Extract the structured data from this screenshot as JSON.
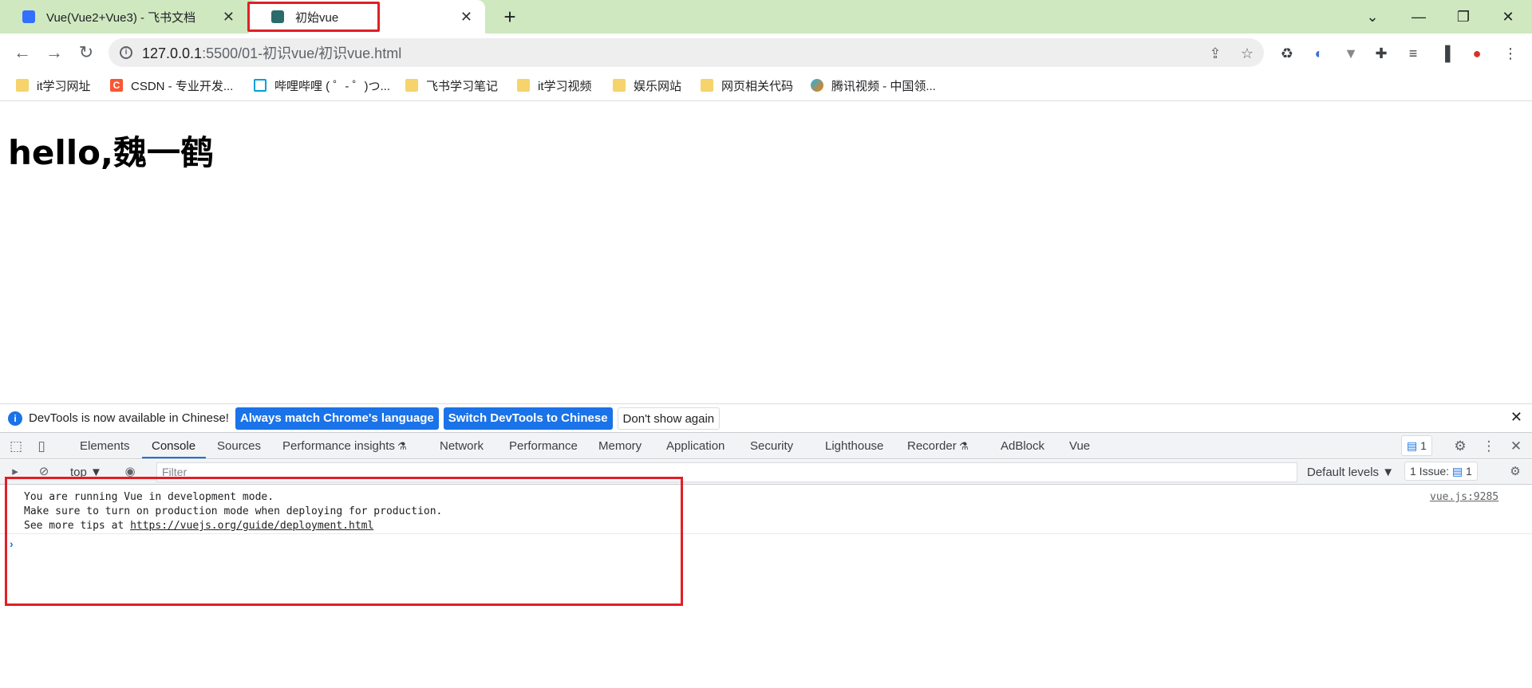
{
  "tabs": [
    {
      "title": "Vue(Vue2+Vue3) - 飞书文档",
      "favicon_color": "#3370ff"
    },
    {
      "title": "初始vue",
      "favicon_color": "#2b6b6b"
    }
  ],
  "address": {
    "host": "127.0.0.1",
    "path": ":5500/01-初识vue/初识vue.html"
  },
  "bookmarks": [
    {
      "label": "it学习网址",
      "icon": "folder-icon"
    },
    {
      "label": "CSDN - 专业开发...",
      "icon": "csdn-icon"
    },
    {
      "label": "哔哩哔哩 ( ゜- ゜)つ...",
      "icon": "bilibili-icon"
    },
    {
      "label": "飞书学习笔记",
      "icon": "folder-icon"
    },
    {
      "label": "it学习视频",
      "icon": "folder-icon"
    },
    {
      "label": "娱乐网站",
      "icon": "folder-icon"
    },
    {
      "label": "网页相关代码",
      "icon": "folder-icon"
    },
    {
      "label": "腾讯视频 - 中国领...",
      "icon": "tencent-video-icon"
    }
  ],
  "page": {
    "heading": "hello,魏一鹤"
  },
  "infobar": {
    "message": "DevTools is now available in Chinese!",
    "btn_match": "Always match Chrome's language",
    "btn_switch": "Switch DevTools to Chinese",
    "btn_dismiss": "Don't show again"
  },
  "devtools_tabs": [
    "Elements",
    "Console",
    "Sources",
    "Performance insights",
    "Network",
    "Performance",
    "Memory",
    "Application",
    "Security",
    "Lighthouse",
    "Recorder",
    "AdBlock",
    "Vue"
  ],
  "devtools": {
    "message_count": "1",
    "context": "top",
    "filter_placeholder": "Filter",
    "default_levels": "Default levels",
    "issues_label": "1 Issue:",
    "issues_count": "1"
  },
  "console": {
    "line1": "You are running Vue in development mode.",
    "line2": "Make sure to turn on production mode when deploying for production.",
    "line3_prefix": "See more tips at ",
    "line3_link": "https://vuejs.org/guide/deployment.html",
    "source": "vue.js:9285"
  },
  "colors": {
    "tabstrip": "#cfe8c0",
    "highlight": "#e01f26",
    "accent": "#1a73e8"
  }
}
